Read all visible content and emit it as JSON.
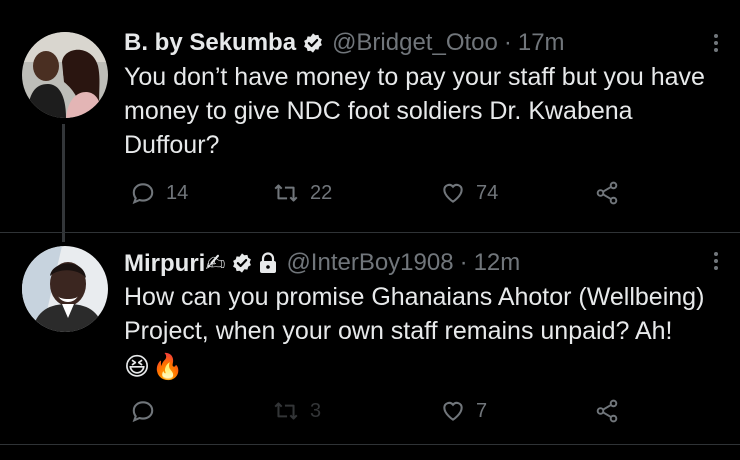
{
  "tweets": [
    {
      "name": "B. by Sekumba",
      "handle": "@Bridget_Otoo",
      "dot": "·",
      "time": "17m",
      "text": "You don’t have money to pay your staff but you have money to give NDC foot soldiers Dr. Kwabena Duffour?",
      "replies": "14",
      "retweets": "22",
      "likes": "74"
    },
    {
      "name": "Mirpuri✍",
      "handle": "@InterBoy1908",
      "dot": "·",
      "time": "12m",
      "text": "How can you promise Ghanaians Ahotor (Wellbeing) Project, when your own staff remains unpaid? Ah!",
      "emojis": [
        "😆",
        "🔥"
      ],
      "replies": "",
      "retweets": "3",
      "likes": "7"
    }
  ],
  "colors": {
    "background": "#000000",
    "text": "#e7e9ea",
    "muted": "#71767b",
    "verified": "#e7e9ea"
  }
}
